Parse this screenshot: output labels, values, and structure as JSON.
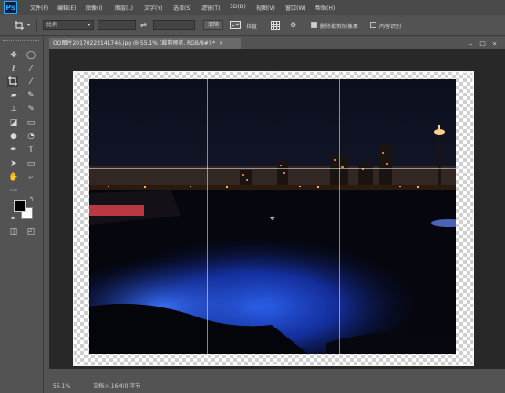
{
  "app": {
    "logo": "Ps",
    "menu": [
      "文件(F)",
      "编辑(E)",
      "图像(I)",
      "图层(L)",
      "文字(Y)",
      "选择(S)",
      "滤镜(T)",
      "3D(D)",
      "视图(V)",
      "窗口(W)",
      "帮助(H)"
    ]
  },
  "options": {
    "tool_icon": "crop-icon",
    "ratio_value": "比例",
    "clear_label": "清除",
    "straighten_label": "拉直",
    "delete_cropped_label": "删除裁剪的像素",
    "delete_cropped_checked": true,
    "content_aware_label": "内容识别",
    "content_aware_checked": false
  },
  "document": {
    "tab_title": "QQ图片20170223141746.jpg @ 55.1% (裁剪预览, RGB/8#) *",
    "close_glyph": "×",
    "window_controls": [
      "–",
      "□",
      "×"
    ]
  },
  "status": {
    "zoom": "55.1%",
    "doc_info": "文档:4.16M/0 字节"
  },
  "colors": {
    "foreground": "#000000",
    "background": "#ffffff",
    "ps_accent": "#31a8ff"
  },
  "tools": [
    "move-icon",
    "marquee-icon",
    "lasso-icon",
    "magic-wand-icon",
    "crop-icon",
    "eyedropper-icon",
    "healing-brush-icon",
    "brush-icon",
    "clone-stamp-icon",
    "history-brush-icon",
    "eraser-icon",
    "gradient-icon",
    "blur-icon",
    "dodge-icon",
    "pen-icon",
    "type-icon",
    "path-selection-icon",
    "rectangle-shape-icon",
    "hand-icon",
    "zoom-icon",
    "more-tools-icon",
    "quick-mask-icon",
    "screen-mode-icon"
  ]
}
